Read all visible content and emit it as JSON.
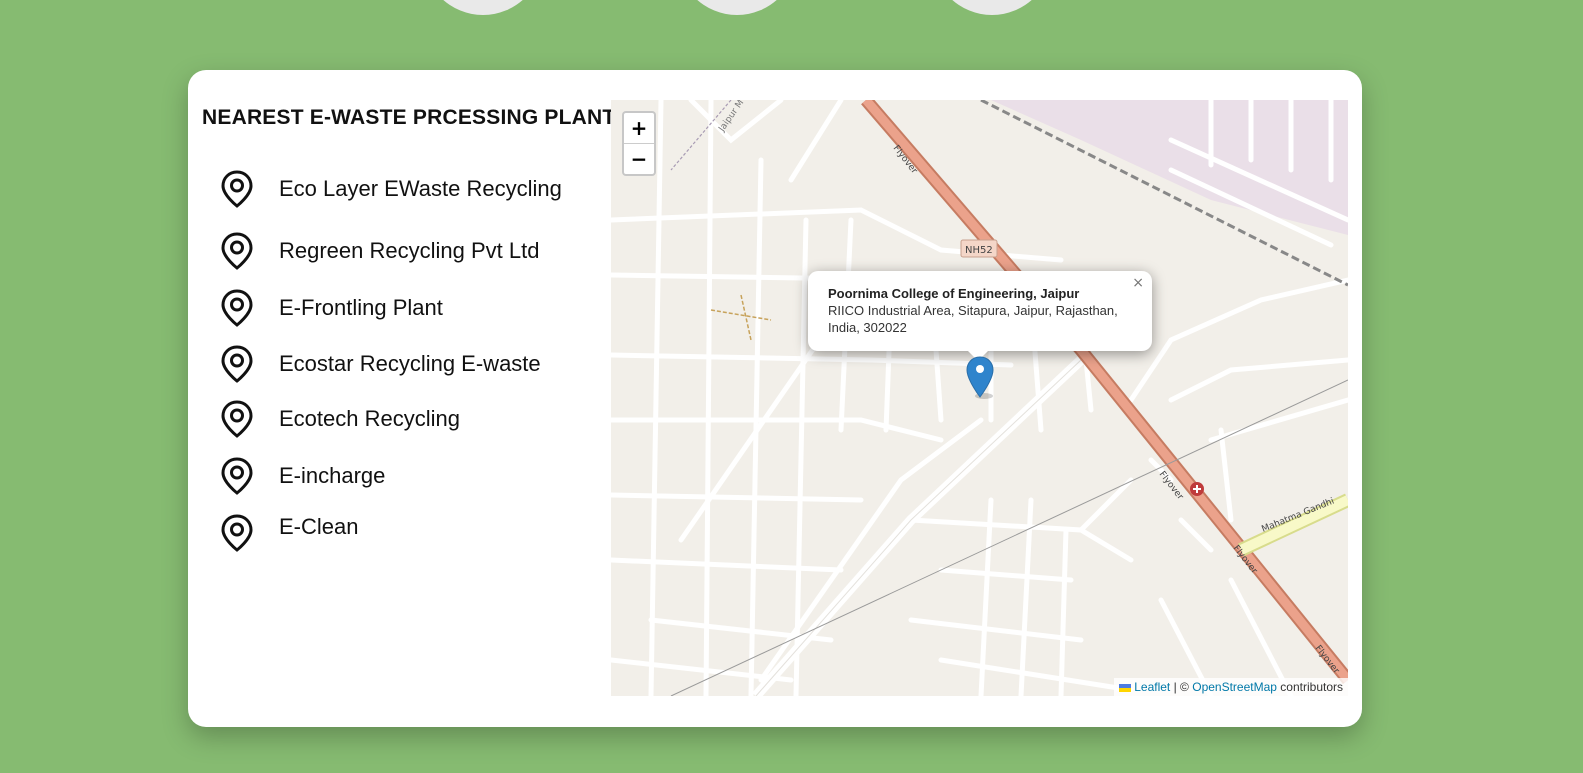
{
  "panel": {
    "title": "NEAREST E-WASTE PRCESSING PLANT",
    "plants": [
      {
        "name": "Eco Layer EWaste Recycling",
        "icon": "location-pin-icon"
      },
      {
        "name": "Regreen Recycling Pvt Ltd",
        "icon": "location-pin-icon"
      },
      {
        "name": "E-Frontling Plant",
        "icon": "location-pin-icon"
      },
      {
        "name": "Ecostar Recycling E-waste",
        "icon": "location-pin-icon"
      },
      {
        "name": "Ecotech Recycling",
        "icon": "location-pin-icon"
      },
      {
        "name": "E-incharge",
        "icon": "location-pin-icon"
      },
      {
        "name": "E-Clean",
        "icon": "location-pin-icon"
      }
    ]
  },
  "map": {
    "zoom_in": "+",
    "zoom_out": "−",
    "popup": {
      "name": "Poornima College of Engineering, Jaipur",
      "address": "RIICO Industrial Area, Sitapura, Jaipur, Rajasthan, India, 302022",
      "close": "×"
    },
    "labels": {
      "flyover": "Flyover",
      "highway": "NH52",
      "mg_road": "Mahatma Gandhi",
      "jaipur_road": "Jaipur M"
    },
    "attribution": {
      "leaflet": "Leaflet",
      "separator": "| ©",
      "osm": "OpenStreetMap",
      "suffix": "contributors"
    }
  },
  "colors": {
    "background": "#86bb71",
    "card": "#ffffff",
    "map_land": "#f2efe9",
    "highway": "#e8927c",
    "marker": "#2f84cc"
  }
}
